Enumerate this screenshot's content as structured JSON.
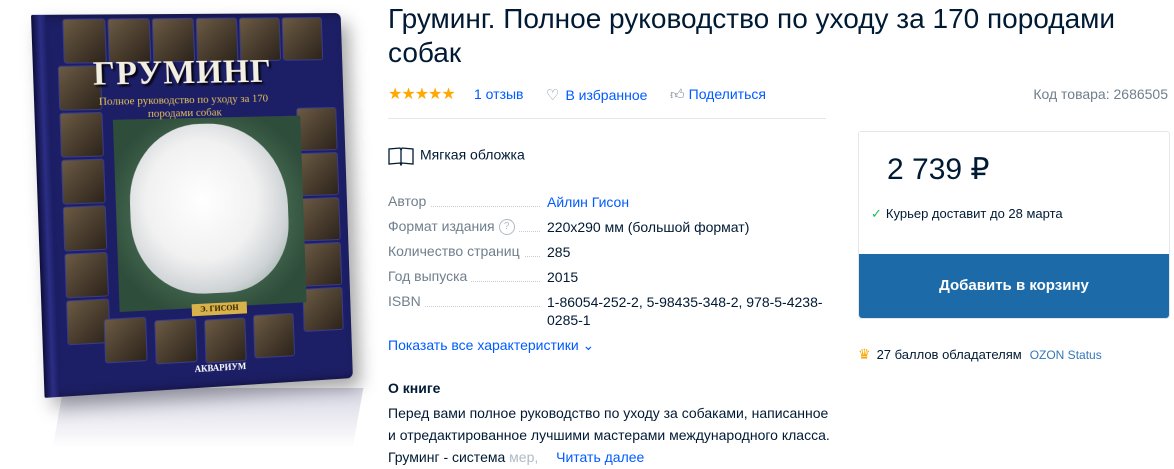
{
  "cover": {
    "title": "ГРУМИНГ",
    "subtitle": "Полное руководство по уходу за 170 породами собак",
    "author": "Э. ГИСОН",
    "publisher": "АКВАРИУМ",
    "bg_color": "#1d1f66"
  },
  "product": {
    "title": "Груминг. Полное руководство по уходу за 170 породами собак",
    "rating_stars": "★★★★★",
    "rating_value": 5,
    "reviews_label": "1 отзыв",
    "favorite_label": "В избранное",
    "share_label": "Поделиться",
    "sku_label": "Код товара: 2686505"
  },
  "binding": {
    "label": "Мягкая обложка",
    "icon": "book-open-icon"
  },
  "specs": [
    {
      "key": "Автор",
      "value": "Айлин Гисон",
      "link": true
    },
    {
      "key": "Формат издания",
      "value": "220x290 мм (большой формат)",
      "help": "?"
    },
    {
      "key": "Количество страниц",
      "value": "285"
    },
    {
      "key": "Год выпуска",
      "value": "2015"
    },
    {
      "key": "ISBN",
      "value": "1-86054-252-2, 5-98435-348-2, 978-5-4238-0285-1"
    }
  ],
  "show_all_label": "Показать все характеристики ⌄",
  "about": {
    "heading": "О книге",
    "text": "Перед вами полное руководство по уходу за собаками, написанное и отредактированное лучшими мастерами международного класса. Груминг - система ",
    "text_fade": "мер, ",
    "read_more": "Читать далее"
  },
  "buy": {
    "price": "2 739 ₽",
    "delivery": "Курьер доставит до 28 марта",
    "add_to_cart": "Добавить в корзину",
    "points": "27 баллов обладателям",
    "status": "OZON Status",
    "accent_color": "#1c6ba8",
    "check_color": "#10c44c"
  }
}
